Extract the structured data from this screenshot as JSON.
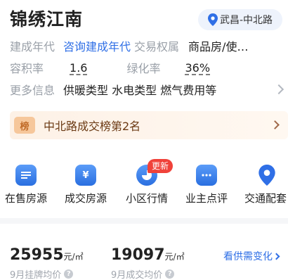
{
  "header": {
    "title": "锦绣江南",
    "location": "武昌-中北路"
  },
  "info": {
    "build_year_label": "建成年代",
    "build_year_value": "咨询建成年代",
    "trade_label": "交易权属",
    "trade_value": "商品房/使…",
    "far_label": "容积率",
    "far_value": "1.6",
    "green_label": "绿化率",
    "green_value": "36%",
    "more_label": "更多信息",
    "more_value": "供暖类型 水电类型 燃气费用等"
  },
  "rank": {
    "badge": "榜",
    "text": "中北路成交榜第2名"
  },
  "nav": {
    "items": [
      {
        "label": "在售房源",
        "icon": "house-list-icon"
      },
      {
        "label": "成交房源",
        "icon": "yen-icon"
      },
      {
        "label": "小区行情",
        "icon": "pie-chart-icon"
      },
      {
        "label": "业主点评",
        "icon": "chat-bubble-icon"
      },
      {
        "label": "交通配套",
        "icon": "map-pin-icon"
      }
    ],
    "new_tag": "更新"
  },
  "prices": {
    "listing_price": "25955",
    "listing_unit": "元/㎡",
    "listing_label": "9月挂牌均价",
    "deal_price": "19097",
    "deal_unit": "元/㎡",
    "deal_label": "9月成交均价",
    "supply_link": "看供需变化"
  },
  "colors": {
    "accent": "#2f6fe6",
    "tag_red": "#f0423a",
    "rank_text": "#6b3a14"
  }
}
